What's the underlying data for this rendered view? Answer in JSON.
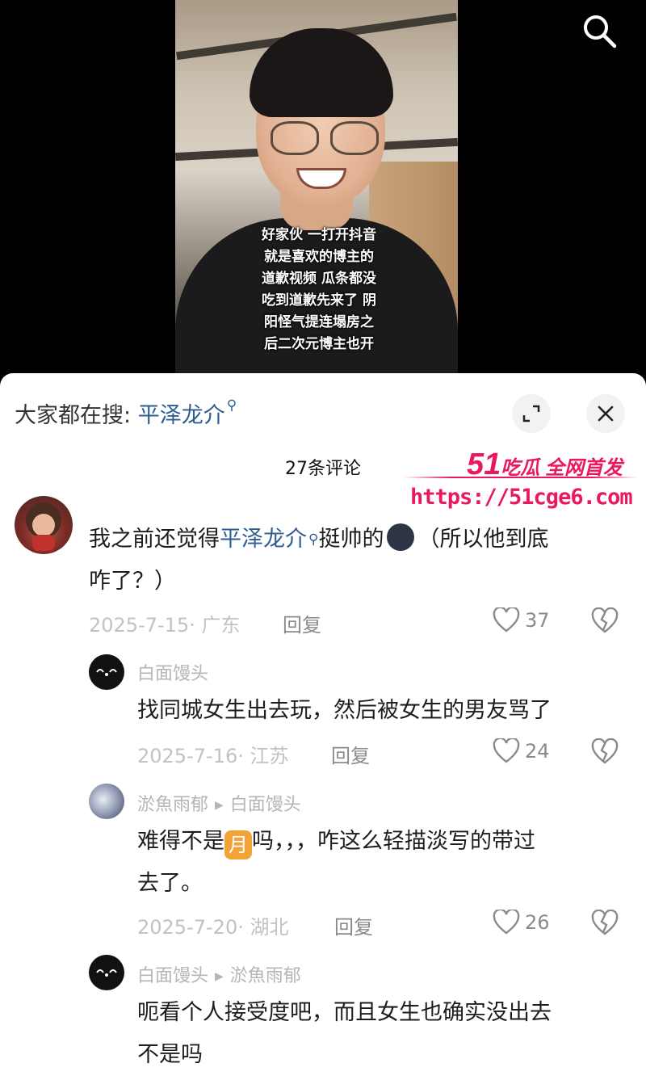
{
  "video": {
    "subtitle_lines": [
      "好家伙 一打开抖音",
      "就是喜欢的博主的",
      "道歉视频 瓜条都没",
      "吃到道歉先来了 阴",
      "阳怪气提连塌房之",
      "后二次元博主也开"
    ]
  },
  "sheet": {
    "search_prefix": "大家都在搜:",
    "search_keyword": "平泽龙介",
    "comment_count_title": "27条评论"
  },
  "watermark": {
    "num": "51",
    "text": "吃瓜 全网首发",
    "url": "https://51cge6.com"
  },
  "comments": [
    {
      "username": "",
      "text_before": "我之前还觉得",
      "keyword": "平泽龙介",
      "text_after": "挺帅的",
      "text_tail": "（所以他到底",
      "text_line2": "咋了？）",
      "date_location": "2025-7-15· 广东",
      "reply_label": "回复",
      "likes": "37"
    },
    {
      "username": "白面馒头",
      "text": "找同城女生出去玩，然后被女生的男友骂了",
      "date_location": "2025-7-16· 江苏",
      "reply_label": "回复",
      "likes": "24"
    },
    {
      "username": "淤魚雨郁",
      "reply_to": "白面馒头",
      "text_before": "难得不是",
      "badge": "月",
      "text_after": "吗，，，咋这么轻描淡写的带过",
      "text_line2": "去了。",
      "date_location": "2025-7-20· 湖北",
      "reply_label": "回复",
      "likes": "26"
    },
    {
      "username": "白面馒头",
      "reply_to": "淤魚雨郁",
      "text_line1": "呃看个人接受度吧，而且女生也确实没出去",
      "text_line2": "不是吗"
    }
  ],
  "colors": {
    "keyword": "#2f5d93",
    "watermark": "#e8195d",
    "meta": "#c2c2c2"
  },
  "icons": [
    "search-icon",
    "expand-icon",
    "close-icon",
    "heart-icon",
    "broken-heart-icon"
  ]
}
